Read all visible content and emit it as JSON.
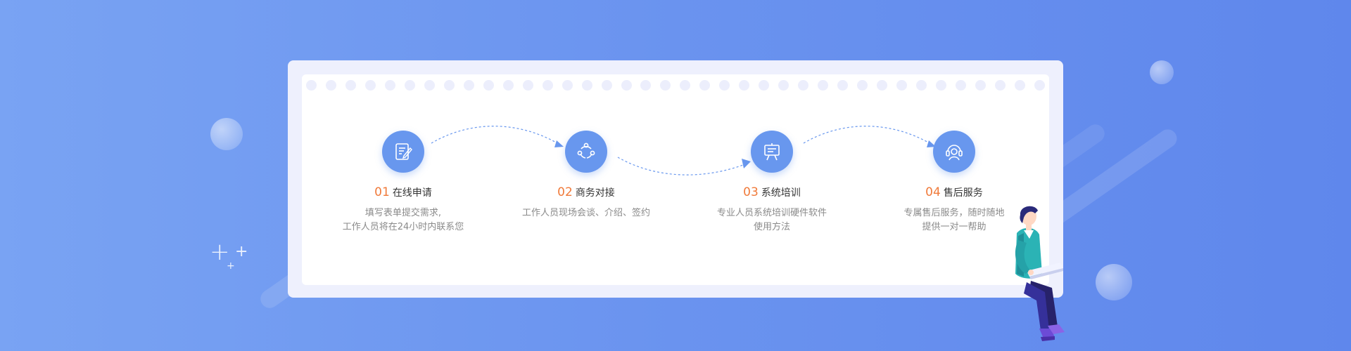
{
  "steps": [
    {
      "number": "01",
      "title": "在线申请",
      "desc_lines": [
        "填写表单提交需求,",
        "工作人员将在24小时内联系您"
      ],
      "icon": "form-edit-icon"
    },
    {
      "number": "02",
      "title": "商务对接",
      "desc_lines": [
        "工作人员现场会谈、介绍、签约"
      ],
      "icon": "share-network-icon"
    },
    {
      "number": "03",
      "title": "系统培训",
      "desc_lines": [
        "专业人员系统培训硬件软件",
        "使用方法"
      ],
      "icon": "presentation-board-icon"
    },
    {
      "number": "04",
      "title": "售后服务",
      "desc_lines": [
        "专属售后服务，随时随地",
        "提供一对一帮助"
      ],
      "icon": "headset-support-icon"
    }
  ],
  "colors": {
    "accent_blue": "#6897ee",
    "number_orange": "#f07a3a",
    "background_start": "#79a3f3",
    "background_end": "#5f87ec"
  },
  "decorations": {
    "illustration": "sitting-person-with-laptop",
    "plus_signs": [
      "+",
      "+",
      "+"
    ]
  }
}
